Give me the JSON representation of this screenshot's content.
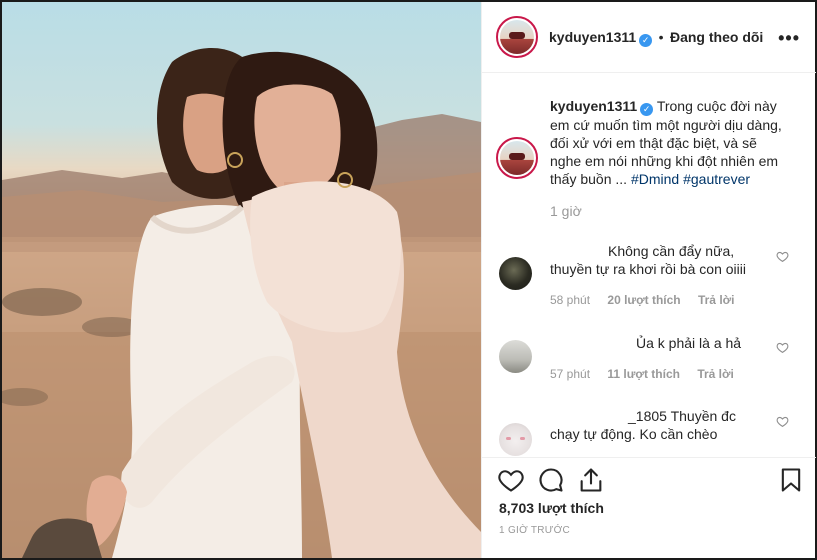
{
  "post": {
    "username": "kyduyen1311",
    "verified_mark": "✓",
    "follow_status": "Đang theo dõi",
    "more_icon": "more-options-icon",
    "caption": {
      "username": "kyduyen1311",
      "lines": [
        "Trong cuộc đời này",
        "em cứ muốn tìm một người dịu dàng,",
        "đối xử với em thật đặc biệt, và sẽ",
        "nghe em nói những khi đột nhiên em",
        "thấy buồn ... "
      ],
      "hashtags": [
        "#Dmind",
        "#gautrever"
      ],
      "time": "1 giờ"
    },
    "comments": [
      {
        "username": "",
        "lines": [
          "Không cần đẩy nữa,",
          "thuyền tự ra khơi rồi bà con oiiii"
        ],
        "time": "58 phút",
        "likes": "20 lượt thích",
        "reply": "Trả lời"
      },
      {
        "username": "",
        "lines": [
          "Ủa k phải là a hả"
        ],
        "time": "57 phút",
        "likes": "11 lượt thích",
        "reply": "Trả lời"
      },
      {
        "username": "",
        "lines": [
          "_1805 Thuyền đc",
          "chạy tự động. Ko cần chèo"
        ],
        "time": "",
        "likes": "",
        "reply": ""
      }
    ],
    "likes_count": "8,703 lượt thích",
    "posted_ago": "1 GIỜ TRƯỚC",
    "icons": [
      "heart-icon",
      "comment-icon",
      "share-icon",
      "bookmark-icon"
    ]
  }
}
